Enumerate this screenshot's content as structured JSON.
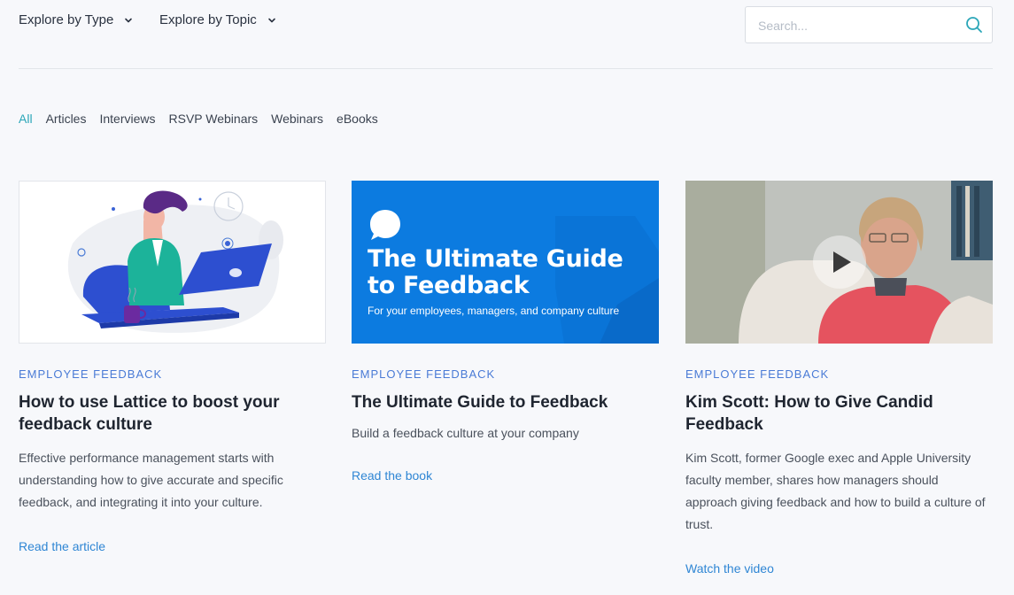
{
  "nav": {
    "explore_type": "Explore by Type",
    "explore_topic": "Explore by Topic",
    "search_placeholder": "Search..."
  },
  "filters": [
    "All",
    "Articles",
    "Interviews",
    "RSVP Webinars",
    "Webinars",
    "eBooks"
  ],
  "active_filter": "All",
  "colors": {
    "accent_teal": "#2aa6b8",
    "tag_blue": "#4a7bd6",
    "link_blue": "#2f86d4",
    "ebook_blue": "#0c7be0"
  },
  "cards": [
    {
      "tag": "EMPLOYEE FEEDBACK",
      "title": "How to use Lattice to boost your feedback culture",
      "description": "Effective performance management starts with understanding how to give accurate and specific feedback, and integrating it into your culture.",
      "link": "Read the article",
      "thumbnail": "illustration-person-laptop"
    },
    {
      "tag": "EMPLOYEE FEEDBACK",
      "title": "The Ultimate Guide to Feedback",
      "description": "Build a feedback culture at your company",
      "link": "Read the book",
      "thumbnail": {
        "headline": "The Ultimate Guide to Feedback",
        "subline": "For your employees, managers, and company culture",
        "icon": "chat-bubble-icon"
      }
    },
    {
      "tag": "EMPLOYEE FEEDBACK",
      "title": "Kim Scott: How to Give Candid Feedback",
      "description": "Kim Scott, former Google exec and Apple University faculty member, shares how managers should approach giving feedback and how to build a culture of trust.",
      "link": "Watch the video",
      "thumbnail": "video-still-with-play-button"
    }
  ]
}
